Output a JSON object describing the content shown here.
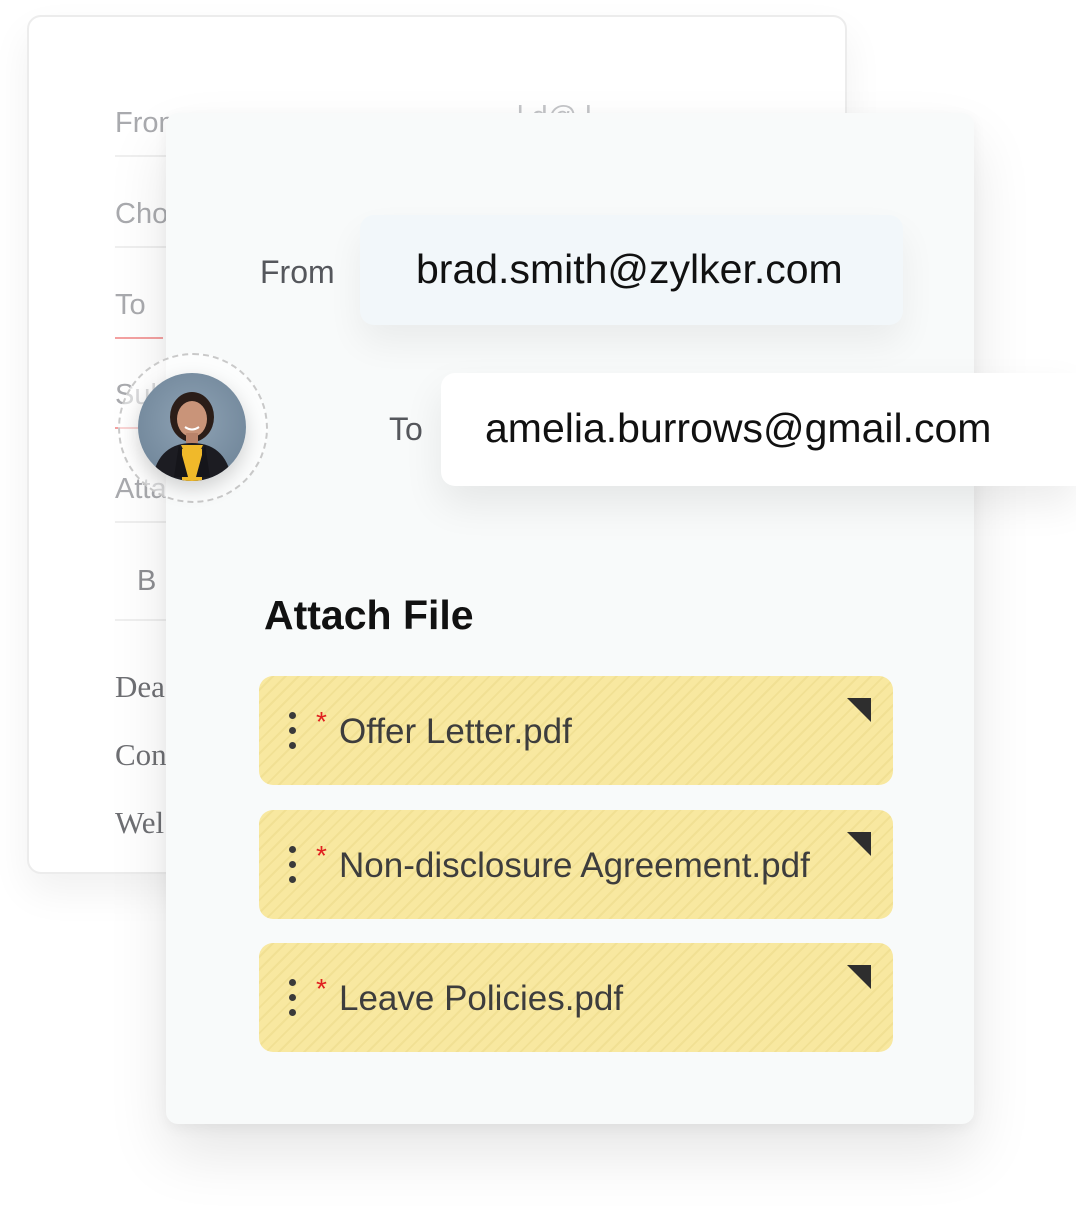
{
  "background_form": {
    "from_label": "From",
    "from_value_faint": "l    d@   l",
    "choose_label": "Cho",
    "to_label": "To",
    "subject_label": "Sub",
    "attach_label": "Atta",
    "bold_button": "B",
    "body_lines": [
      "Dea",
      "Con",
      "Wel"
    ]
  },
  "email": {
    "from_label": "From",
    "from_value": "brad.smith@zylker.com",
    "to_label": "To",
    "to_value": "amelia.burrows@gmail.com"
  },
  "attachments": {
    "title": "Attach File",
    "required_marker": "*",
    "files": [
      {
        "name": "Offer Letter.pdf"
      },
      {
        "name": "Non-disclosure Agreement.pdf"
      },
      {
        "name": "Leave Policies.pdf"
      }
    ]
  },
  "colors": {
    "file_bg": "#f8e8a0",
    "required": "#e02020",
    "accent_underline": "#f4a1a1"
  }
}
